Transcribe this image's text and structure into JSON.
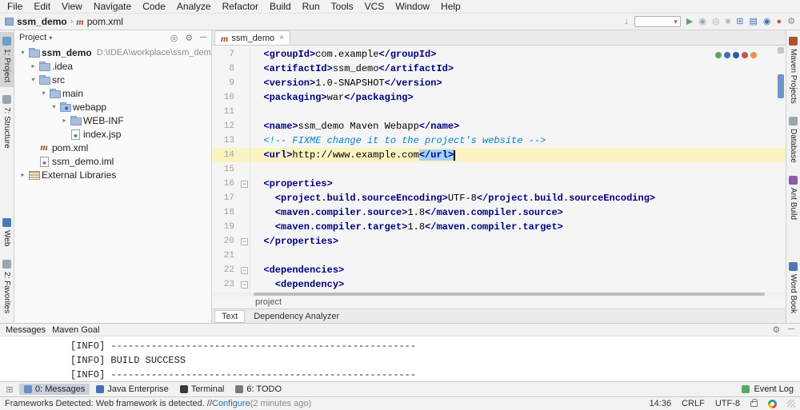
{
  "palette": {
    "selection": "#A6D2FF",
    "caret_row": "#FBF4C2",
    "xml_tag": "#000080",
    "todo_comment": "#0080D0",
    "chrome_bg": "#F2F2F2",
    "editor_bg": "#F5F5F5"
  },
  "icons": {
    "maven_glyph": "m",
    "crumb_sep": "›",
    "combo_caret": "▾",
    "fold_minus": "−",
    "close_glyph": "×",
    "corner_glyph": "⊞"
  },
  "menubar": {
    "items": [
      "File",
      "Edit",
      "View",
      "Navigate",
      "Code",
      "Analyze",
      "Refactor",
      "Build",
      "Run",
      "Tools",
      "VCS",
      "Window",
      "Help"
    ]
  },
  "toolbar": {
    "project": "ssm_demo",
    "file": "pom.xml",
    "icons_pre": [
      {
        "name": "attach-download-icon",
        "glyph": "↓",
        "color": "#7F8B91"
      }
    ],
    "icons": [
      {
        "name": "run-icon",
        "glyph": "▶",
        "color": "#59A869"
      },
      {
        "name": "debug-icon",
        "glyph": "◉",
        "color": "#9AA7B0"
      },
      {
        "name": "coverage-icon",
        "glyph": "◎",
        "color": "#9AA7B0"
      },
      {
        "name": "stop-icon",
        "glyph": "■",
        "color": "#BDBDBD"
      },
      {
        "name": "window-grid-icon",
        "glyph": "⊞",
        "color": "#4A7AB5"
      },
      {
        "name": "blue-plugin-icon",
        "glyph": "▤",
        "color": "#3C6EB4"
      },
      {
        "name": "translate-plugin-icon",
        "glyph": "◉",
        "color": "#3C6EB4"
      },
      {
        "name": "red-plugin-icon",
        "glyph": "●",
        "color": "#C75450"
      },
      {
        "name": "settings-icon",
        "glyph": "⚙",
        "color": "#7F8B91"
      }
    ]
  },
  "left_stripe": {
    "top": [
      {
        "label": "1: Project",
        "active": true,
        "color": "#6E9ECE"
      },
      {
        "label": "7: Structure",
        "active": false,
        "color": "#9AA7B0"
      }
    ],
    "bottom": [
      {
        "label": "Web",
        "active": false,
        "color": "#4A7AB5"
      },
      {
        "label": "2: Favorites",
        "active": false,
        "color": "#9AA7B0"
      }
    ]
  },
  "right_stripe": {
    "top": [
      {
        "label": "Maven Projects",
        "active": false,
        "color": "#B0522E"
      },
      {
        "label": "Database",
        "active": false,
        "color": "#9AA7B0"
      },
      {
        "label": "Ant Build",
        "active": false,
        "color": "#8E5BA6"
      }
    ],
    "bottom": [
      {
        "label": "Word Book",
        "active": false,
        "color": "#4A7AB5"
      }
    ]
  },
  "project_panel": {
    "title": "Project",
    "title_caret": "▾",
    "header_icons": [
      {
        "name": "locate-icon",
        "glyph": "◎"
      },
      {
        "name": "settings-gear-icon",
        "glyph": "⚙"
      },
      {
        "name": "hide-panel-icon",
        "glyph": "─"
      }
    ],
    "tree": [
      {
        "depth": 0,
        "chevron": "v",
        "icon": "folder-root",
        "label": "ssm_demo",
        "extra": "D:\\IDEA\\workplace\\ssm_demo",
        "bold": true
      },
      {
        "depth": 1,
        "chevron": ">",
        "icon": "folder",
        "label": ".idea",
        "extra": ""
      },
      {
        "depth": 1,
        "chevron": "v",
        "icon": "folder",
        "label": "src",
        "extra": ""
      },
      {
        "depth": 2,
        "chevron": "v",
        "icon": "folder",
        "label": "main",
        "extra": ""
      },
      {
        "depth": 3,
        "chevron": "v",
        "icon": "folder-web",
        "label": "webapp",
        "extra": ""
      },
      {
        "depth": 4,
        "chevron": ">",
        "icon": "folder",
        "label": "WEB-INF",
        "extra": ""
      },
      {
        "depth": 4,
        "chevron": "",
        "icon": "file-jsp",
        "label": "index.jsp",
        "extra": ""
      },
      {
        "depth": 1,
        "chevron": "",
        "icon": "maven",
        "label": "pom.xml",
        "extra": ""
      },
      {
        "depth": 1,
        "chevron": "",
        "icon": "file-iml",
        "label": "ssm_demo.iml",
        "extra": ""
      },
      {
        "depth": 0,
        "chevron": ">",
        "icon": "lib",
        "label": "External Libraries",
        "extra": ""
      }
    ]
  },
  "editor": {
    "tab_label": "ssm_demo",
    "breadcrumb": "project",
    "bottom_tabs": [
      {
        "label": "Text",
        "active": true
      },
      {
        "label": "Dependency Analyzer",
        "active": false
      }
    ],
    "widget_dots": [
      "#59A869",
      "#3B6FB5",
      "#2B5AA0",
      "#C75450",
      "#E8953C"
    ],
    "lines": [
      {
        "n": 7,
        "segs": [
          {
            "c": "tag",
            "t": "  <groupId>"
          },
          {
            "c": "plain",
            "t": "com.example"
          },
          {
            "c": "tag",
            "t": "</groupId>"
          }
        ]
      },
      {
        "n": 8,
        "segs": [
          {
            "c": "tag",
            "t": "  <artifactId>"
          },
          {
            "c": "plain",
            "t": "ssm_demo"
          },
          {
            "c": "tag",
            "t": "</artifactId>"
          }
        ]
      },
      {
        "n": 9,
        "segs": [
          {
            "c": "tag",
            "t": "  <version>"
          },
          {
            "c": "plain",
            "t": "1.0-SNAPSHOT"
          },
          {
            "c": "tag",
            "t": "</version>"
          }
        ]
      },
      {
        "n": 10,
        "segs": [
          {
            "c": "tag",
            "t": "  <packaging>"
          },
          {
            "c": "plain",
            "t": "war"
          },
          {
            "c": "tag",
            "t": "</packaging>"
          }
        ]
      },
      {
        "n": 11,
        "segs": []
      },
      {
        "n": 12,
        "segs": [
          {
            "c": "tag",
            "t": "  <name>"
          },
          {
            "c": "plain",
            "t": "ssm_demo Maven Webapp"
          },
          {
            "c": "tag",
            "t": "</name>"
          }
        ]
      },
      {
        "n": 13,
        "segs": [
          {
            "c": "comment",
            "t": "  <!-- FIXME change it to the project's website -->"
          }
        ]
      },
      {
        "n": 14,
        "active": true,
        "segs": [
          {
            "c": "tag",
            "t": "  <url>"
          },
          {
            "c": "plain",
            "t": "http://www.example.com"
          },
          {
            "c": "tag sel",
            "t": "</url>"
          },
          {
            "c": "caret",
            "t": ""
          }
        ]
      },
      {
        "n": 15,
        "segs": []
      },
      {
        "n": 16,
        "fold": "-",
        "segs": [
          {
            "c": "tag",
            "t": "  <properties>"
          }
        ]
      },
      {
        "n": 17,
        "segs": [
          {
            "c": "tag",
            "t": "    <project.build.sourceEncoding>"
          },
          {
            "c": "plain",
            "t": "UTF-8"
          },
          {
            "c": "tag",
            "t": "</project.build.sourceEncoding>"
          }
        ]
      },
      {
        "n": 18,
        "segs": [
          {
            "c": "tag",
            "t": "    <maven.compiler.source>"
          },
          {
            "c": "plain",
            "t": "1.8"
          },
          {
            "c": "tag",
            "t": "</maven.compiler.source>"
          }
        ]
      },
      {
        "n": 19,
        "segs": [
          {
            "c": "tag",
            "t": "    <maven.compiler.target>"
          },
          {
            "c": "plain",
            "t": "1.8"
          },
          {
            "c": "tag",
            "t": "</maven.compiler.target>"
          }
        ]
      },
      {
        "n": 20,
        "fold": "-",
        "segs": [
          {
            "c": "tag",
            "t": "  </properties>"
          }
        ]
      },
      {
        "n": 21,
        "segs": []
      },
      {
        "n": 22,
        "fold": "-",
        "segs": [
          {
            "c": "tag",
            "t": "  <dependencies>"
          }
        ]
      },
      {
        "n": 23,
        "fold": "-",
        "segs": [
          {
            "c": "tag",
            "t": "    <dependency>"
          }
        ]
      }
    ]
  },
  "messages": {
    "title": "Messages",
    "subtitle": "Maven Goal",
    "header_icons": [
      {
        "name": "settings-gear-icon",
        "glyph": "⚙"
      },
      {
        "name": "hide-panel-icon",
        "glyph": "─"
      }
    ],
    "lines": [
      "[INFO] -----------------------------------------------------",
      "[INFO] BUILD SUCCESS",
      "[INFO] -----------------------------------------------------"
    ]
  },
  "toolwindow_bar": {
    "buttons": [
      {
        "label": "0: Messages",
        "active": true,
        "color": "#6A8CC7"
      },
      {
        "label": "Java Enterprise",
        "active": false,
        "color": "#4470B8"
      },
      {
        "label": "Terminal",
        "active": false,
        "color": "#3A3A3A"
      },
      {
        "label": "6: TODO",
        "active": false,
        "color": "#7A7A7A"
      }
    ],
    "right": {
      "label": "Event Log",
      "color": "#59A869"
    }
  },
  "statusbar": {
    "message_prefix": "Frameworks Detected: Web framework is detected. // ",
    "message_link": "Configure",
    "message_suffix": " (2 minutes ago)",
    "caret_position": "14:36",
    "line_separator": "CRLF",
    "encoding": "UTF-8"
  }
}
